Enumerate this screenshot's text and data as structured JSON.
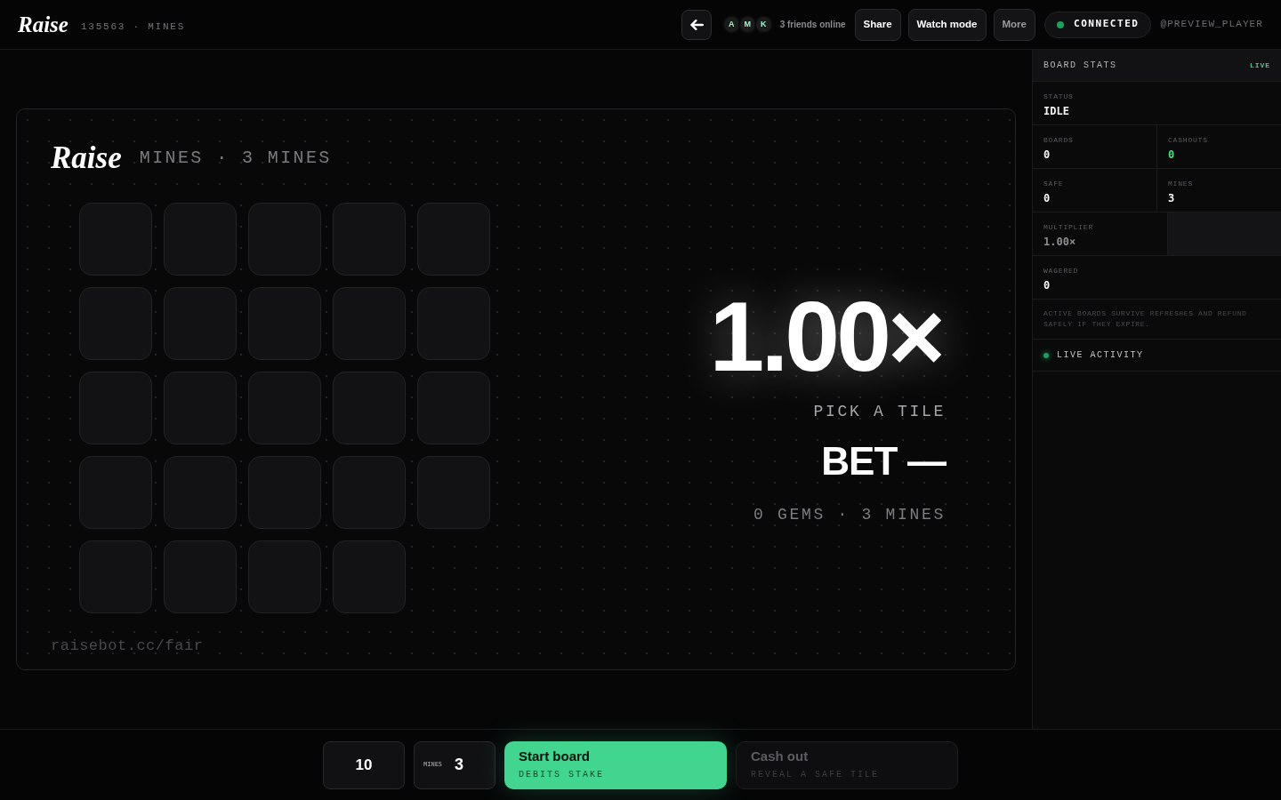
{
  "header": {
    "logo": "Raise",
    "subtitle": "135563 · MINES"
  },
  "toolbar": {
    "friends": [
      {
        "initial": "A"
      },
      {
        "initial": "M"
      },
      {
        "initial": "K"
      }
    ],
    "friends_label": "3 friends online",
    "buttons": [
      {
        "label": "Share",
        "disabled": false
      },
      {
        "label": "Watch mode",
        "disabled": false
      },
      {
        "label": "More",
        "disabled": true
      }
    ],
    "connection": {
      "label": "CONNECTED",
      "online": true
    },
    "user": "@PREVIEW_PLAYER"
  },
  "board": {
    "logo": "Raise",
    "subtitle": "MINES · 3 MINES",
    "tiles": [
      {
        "revealed": false
      },
      {
        "revealed": false
      },
      {
        "revealed": false
      },
      {
        "revealed": false
      },
      {
        "revealed": false
      },
      {
        "revealed": false
      },
      {
        "revealed": false
      },
      {
        "revealed": false
      },
      {
        "revealed": false
      },
      {
        "revealed": false
      },
      {
        "revealed": false
      },
      {
        "revealed": false
      },
      {
        "revealed": false
      },
      {
        "revealed": false
      },
      {
        "revealed": false
      },
      {
        "revealed": false
      },
      {
        "revealed": false
      },
      {
        "revealed": false
      },
      {
        "revealed": false
      },
      {
        "revealed": false
      },
      {
        "revealed": false
      },
      {
        "revealed": false
      },
      {
        "revealed": false
      },
      {
        "revealed": false
      }
    ],
    "fair_link": "raisebot.cc/fair",
    "readout": {
      "multiplier": "1.00×",
      "prompt": "PICK A TILE",
      "bet": "BET —",
      "summary": "0 GEMS · 3 MINES"
    }
  },
  "sidebar": {
    "title": "BOARD STATS",
    "badge": "LIVE",
    "rows": [
      [
        {
          "kind": "stat",
          "label": "STATUS",
          "value": "IDLE",
          "color": "#f4f4f5"
        }
      ],
      [
        {
          "kind": "stat",
          "label": "BOARDS",
          "value": "0",
          "color": "#f4f4f5"
        },
        {
          "kind": "stat",
          "label": "CASHOUTS",
          "value": "0",
          "color": "#4ade80"
        }
      ],
      [
        {
          "kind": "stat",
          "label": "SAFE",
          "value": "0",
          "color": "#f4f4f5"
        },
        {
          "kind": "stat",
          "label": "MINES",
          "value": "3",
          "color": "#f4f4f5"
        }
      ],
      [
        {
          "kind": "stat",
          "label": "MULTIPLIER",
          "value": "1.00×",
          "color": "#8e8e93"
        },
        {
          "kind": "blank"
        }
      ],
      [
        {
          "kind": "stat",
          "label": "WAGERED",
          "value": "0",
          "color": "#f4f4f5"
        }
      ]
    ],
    "note": "ACTIVE BOARDS SURVIVE REFRESHES AND REFUND SAFELY IF THEY EXPIRE.",
    "activity": {
      "label": "LIVE ACTIVITY",
      "live": true
    }
  },
  "controls": {
    "bet_amount": "10",
    "mines": {
      "label": "MINES",
      "value": "3"
    },
    "actions": [
      {
        "title": "Start board",
        "subtitle": "DEBITS STAKE",
        "disabled": false
      },
      {
        "title": "Cash out",
        "subtitle": "REVEAL A SAFE TILE",
        "disabled": true
      }
    ]
  }
}
